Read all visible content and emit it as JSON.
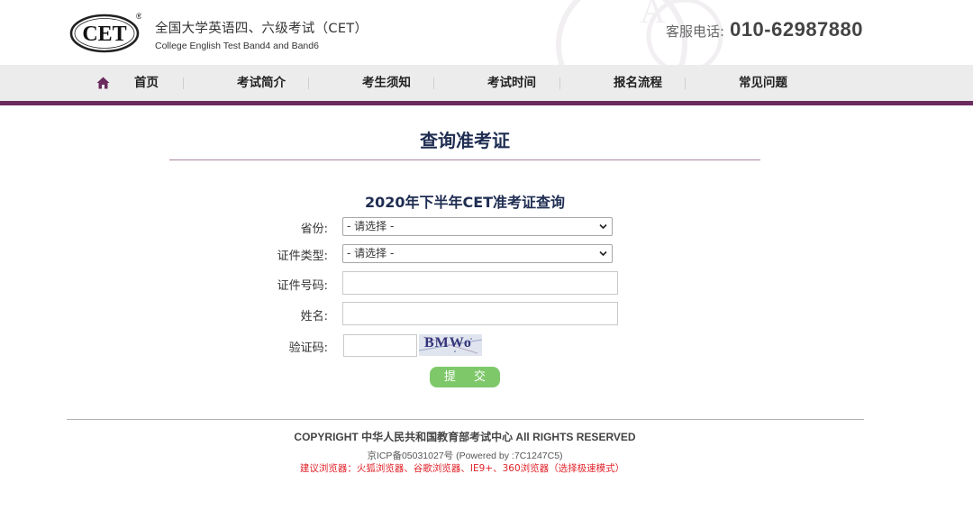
{
  "header": {
    "logo_text": "CET",
    "logo_mark": "®",
    "title_cn": "全国大学英语四、六级考试（CET）",
    "title_en": "College English Test Band4 and Band6",
    "hotline_label": "客服电话:",
    "hotline_number": "010-62987880"
  },
  "nav": {
    "items": [
      {
        "label": "首页",
        "icon": "home-icon"
      },
      {
        "label": "考试简介"
      },
      {
        "label": "考生须知"
      },
      {
        "label": "考试时间"
      },
      {
        "label": "报名流程"
      },
      {
        "label": "常见问题"
      }
    ]
  },
  "main": {
    "page_title": "查询准考证",
    "form_title": "2020年下半年CET准考证查询",
    "fields": {
      "province": {
        "label": "省份:",
        "value": "- 请选择 -"
      },
      "id_type": {
        "label": "证件类型:",
        "value": "- 请选择 -"
      },
      "id_number": {
        "label": "证件号码:",
        "value": ""
      },
      "name": {
        "label": "姓名:",
        "value": ""
      },
      "captcha": {
        "label": "验证码:",
        "value": "",
        "image_text": "BMWo"
      }
    },
    "submit_label": "提 交"
  },
  "footer": {
    "copyright": "COPYRIGHT 中华人民共和国教育部考试中心 All RIGHTS RESERVED",
    "icp": "京ICP备05031027号 (Powered by :7C1247C5)",
    "browser_note": "建议浏览器：火狐浏览器、谷歌浏览器、IE9+、360浏览器（选择极速模式）"
  },
  "colors": {
    "nav_border": "#6b2b5e",
    "title": "#1f2d52",
    "submit": "#7ec86a",
    "browser_note": "#e0242b"
  }
}
